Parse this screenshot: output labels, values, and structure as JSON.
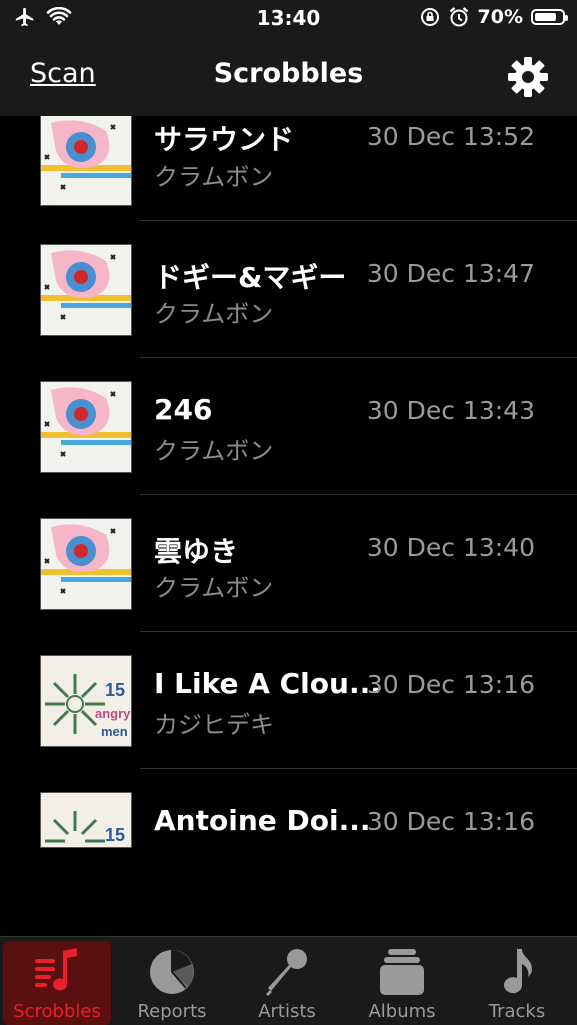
{
  "status_bar": {
    "time": "13:40",
    "battery": "70%",
    "icons": [
      "airplane-icon",
      "wifi-icon",
      "orientation-lock-icon",
      "alarm-icon",
      "battery-icon"
    ]
  },
  "nav": {
    "left_label": "Scan",
    "title": "Scrobbles",
    "right_icon": "gear-icon"
  },
  "scrobbles": [
    {
      "title": "サラウンド",
      "artist": "クラムボン",
      "time": "30 Dec 13:52",
      "art": "album-art-clammbon"
    },
    {
      "title": "ドギー&マギー",
      "artist": "クラムボン",
      "time": "30 Dec 13:47",
      "art": "album-art-clammbon"
    },
    {
      "title": "246",
      "artist": "クラムボン",
      "time": "30 Dec 13:43",
      "art": "album-art-clammbon"
    },
    {
      "title": "雲ゆき",
      "artist": "クラムボン",
      "time": "30 Dec 13:40",
      "art": "album-art-clammbon"
    },
    {
      "title": "I Like A Clou...",
      "artist": "カジヒデキ",
      "time": "30 Dec 13:16",
      "art": "album-art-15-angry-men"
    },
    {
      "title": "Antoine Doi...",
      "artist": "",
      "time": "30 Dec 13:16",
      "art": "album-art-15-angry-men"
    }
  ],
  "tabs": [
    {
      "label": "Scrobbles",
      "icon": "music-list-icon",
      "active": true
    },
    {
      "label": "Reports",
      "icon": "pie-chart-icon",
      "active": false
    },
    {
      "label": "Artists",
      "icon": "microphone-icon",
      "active": false
    },
    {
      "label": "Albums",
      "icon": "album-stack-icon",
      "active": false
    },
    {
      "label": "Tracks",
      "icon": "music-note-icon",
      "active": false
    }
  ],
  "colors": {
    "accent": "#e8202a",
    "active_tab_bg": "#5a1010",
    "bar_bg": "#1a1a1a",
    "secondary_text": "#8c8c8c"
  }
}
